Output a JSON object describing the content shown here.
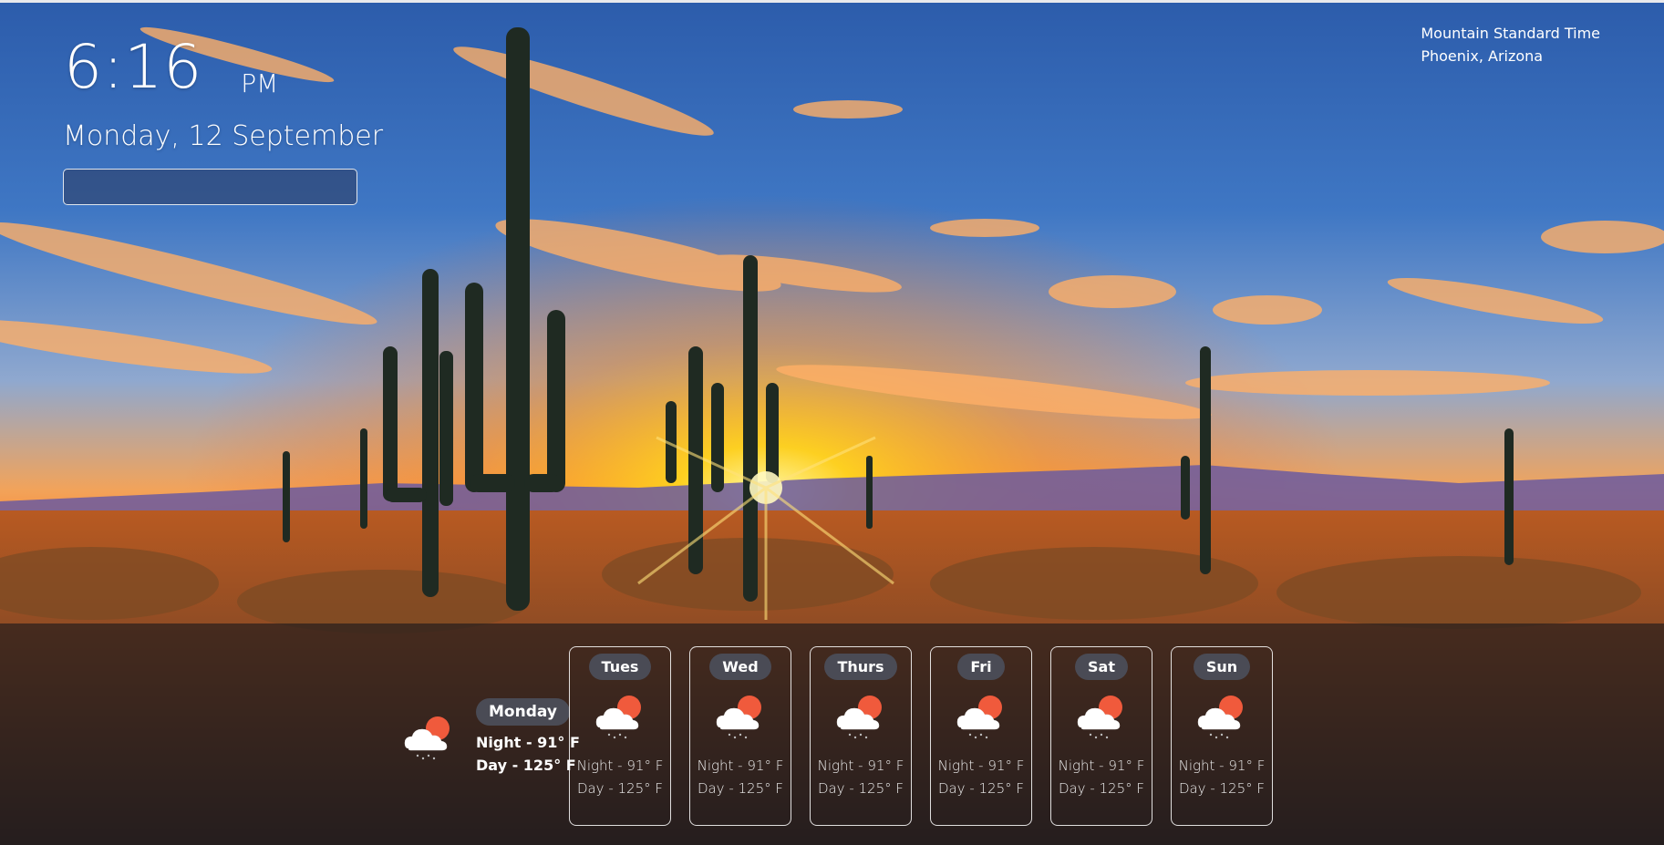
{
  "clock": {
    "time": "6:16",
    "ampm": "PM",
    "date": "Monday, 12 September"
  },
  "search": {
    "value": "",
    "placeholder": ""
  },
  "timezone": {
    "name": "Mountain Standard Time",
    "location": "Phoenix, Arizona"
  },
  "today": {
    "day": "Monday",
    "night": "Night - 91° F",
    "dayline": "Day - 125° F",
    "icon": "cloud-sun-rain-icon"
  },
  "forecast": [
    {
      "day": "Tues",
      "night": "Night - 91° F",
      "dayline": "Day - 125° F",
      "icon": "cloud-sun-rain-icon"
    },
    {
      "day": "Wed",
      "night": "Night - 91° F",
      "dayline": "Day - 125° F",
      "icon": "cloud-sun-rain-icon"
    },
    {
      "day": "Thurs",
      "night": "Night - 91° F",
      "dayline": "Day - 125° F",
      "icon": "cloud-sun-rain-icon"
    },
    {
      "day": "Fri",
      "night": "Night - 91° F",
      "dayline": "Day - 125° F",
      "icon": "cloud-sun-rain-icon"
    },
    {
      "day": "Sat",
      "night": "Night - 91° F",
      "dayline": "Day - 125° F",
      "icon": "cloud-sun-rain-icon"
    },
    {
      "day": "Sun",
      "night": "Night - 91° F",
      "dayline": "Day - 125° F",
      "icon": "cloud-sun-rain-icon"
    }
  ],
  "colors": {
    "sun": "#f05a3c",
    "cloud": "#ffffff",
    "panel": "#19161c",
    "pill": "#4a4b55"
  }
}
